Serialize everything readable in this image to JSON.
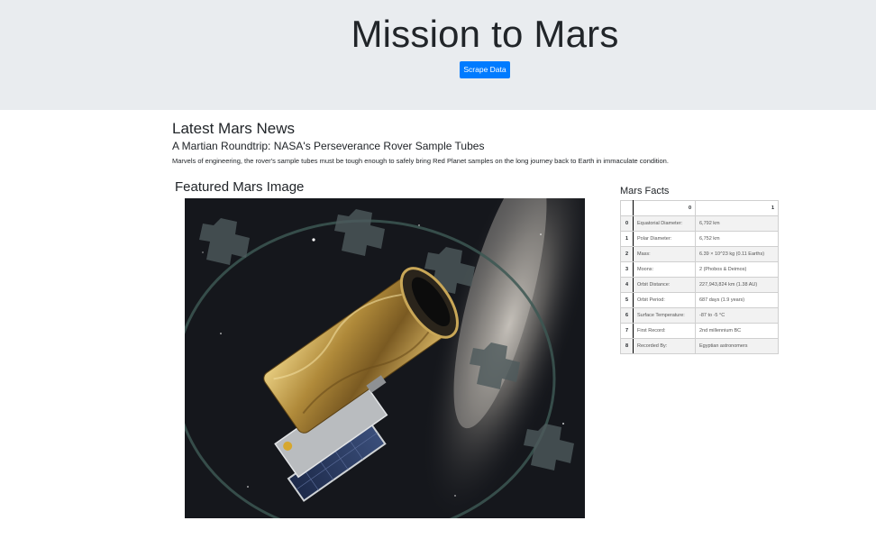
{
  "header": {
    "title": "Mission to Mars",
    "scrape_button": "Scrape Data"
  },
  "news": {
    "heading": "Latest Mars News",
    "title": "A Martian Roundtrip: NASA's Perseverance Rover Sample Tubes",
    "teaser": "Marvels of engineering, the rover's sample tubes must be tough enough to safely bring Red Planet samples on the long journey back to Earth in immaculate condition."
  },
  "featured": {
    "heading": "Featured Mars Image"
  },
  "facts": {
    "heading": "Mars Facts",
    "columns": [
      "",
      "0",
      "1"
    ],
    "rows": [
      {
        "index": "0",
        "label": "Equatorial Diameter:",
        "value": "6,792 km"
      },
      {
        "index": "1",
        "label": "Polar Diameter:",
        "value": "6,752 km"
      },
      {
        "index": "2",
        "label": "Mass:",
        "value": "6.39 × 10^23 kg (0.11 Earths)"
      },
      {
        "index": "3",
        "label": "Moons:",
        "value": "2 (Phobos & Deimos)"
      },
      {
        "index": "4",
        "label": "Orbit Distance:",
        "value": "227,943,824 km (1.38 AU)"
      },
      {
        "index": "5",
        "label": "Orbit Period:",
        "value": "687 days (1.9 years)"
      },
      {
        "index": "6",
        "label": "Surface Temperature:",
        "value": "-87 to -5 °C"
      },
      {
        "index": "7",
        "label": "First Record:",
        "value": "2nd millennium BC"
      },
      {
        "index": "8",
        "label": "Recorded By:",
        "value": "Egyptian astronomers"
      }
    ]
  }
}
